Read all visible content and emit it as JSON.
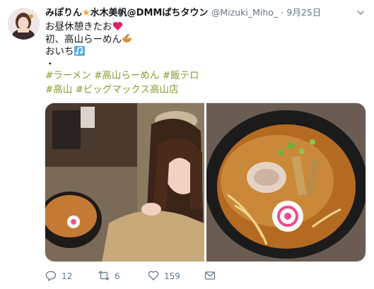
{
  "tweet": {
    "display_name": "みぽりん",
    "display_name_rest": "水木美帆@DMMぱちタウン",
    "handle": "@Mizuki_Miho_",
    "separator": "·",
    "date": "9月25日",
    "lines": [
      "お昼休憩きたお",
      "初、高山らーめん",
      "おいち",
      "・"
    ],
    "hashtags_line1": [
      "#ラーメン",
      "#高山らーめん",
      "#飯テロ"
    ],
    "hashtags_line2": [
      "#高山",
      "#ビッグマックス高山店"
    ],
    "actions": {
      "reply_count": "12",
      "retweet_count": "6",
      "like_count": "159"
    }
  },
  "colors": {
    "hashtag": "#8a9a2f",
    "muted": "#657786",
    "star": "#f5a623",
    "heart_emoji": "#e0245e"
  },
  "icons": {
    "reply": "reply-icon",
    "retweet": "retweet-icon",
    "like": "heart-icon",
    "dm": "envelope-icon",
    "menu": "chevron-down-icon"
  }
}
